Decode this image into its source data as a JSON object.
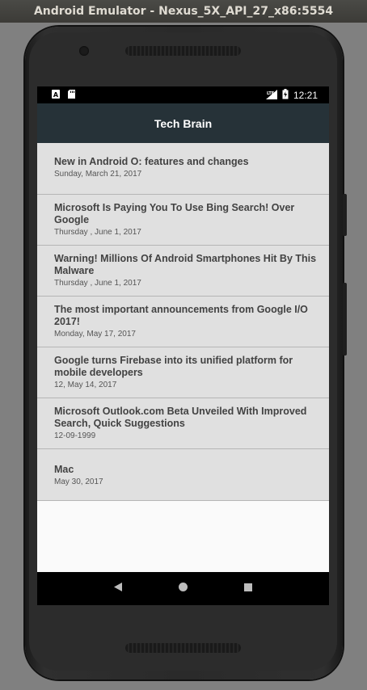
{
  "window": {
    "title": "Android Emulator - Nexus_5X_API_27_x86:5554"
  },
  "status_bar": {
    "left_icons": [
      "a-notification-icon",
      "sd-card-icon"
    ],
    "right_icons": [
      "lte-signal-icon",
      "battery-icon"
    ],
    "time": "12:21"
  },
  "app_bar": {
    "title": "Tech Brain"
  },
  "articles": [
    {
      "title": "New in Android O: features and changes",
      "date": "Sunday, March 21,  2017"
    },
    {
      "title": "Microsoft Is Paying You To Use Bing Search! Over Google",
      "date": "Thursday , June 1, 2017"
    },
    {
      "title": "Warning! Millions Of Android Smartphones Hit By This Malware",
      "date": "Thursday , June 1, 2017"
    },
    {
      "title": "The most important announcements from Google I/O 2017!",
      "date": "Monday,  May 17, 2017"
    },
    {
      "title": "Google turns Firebase into its unified platform for mobile developers",
      "date": "12, May 14, 2017"
    },
    {
      "title": "Microsoft Outlook.com Beta Unveiled With Improved Search, Quick Suggestions",
      "date": "12-09-1999"
    },
    {
      "title": "Mac",
      "date": "May 30, 2017"
    }
  ],
  "nav_bar": {
    "icons": [
      "back-icon",
      "home-icon",
      "recents-icon"
    ]
  }
}
